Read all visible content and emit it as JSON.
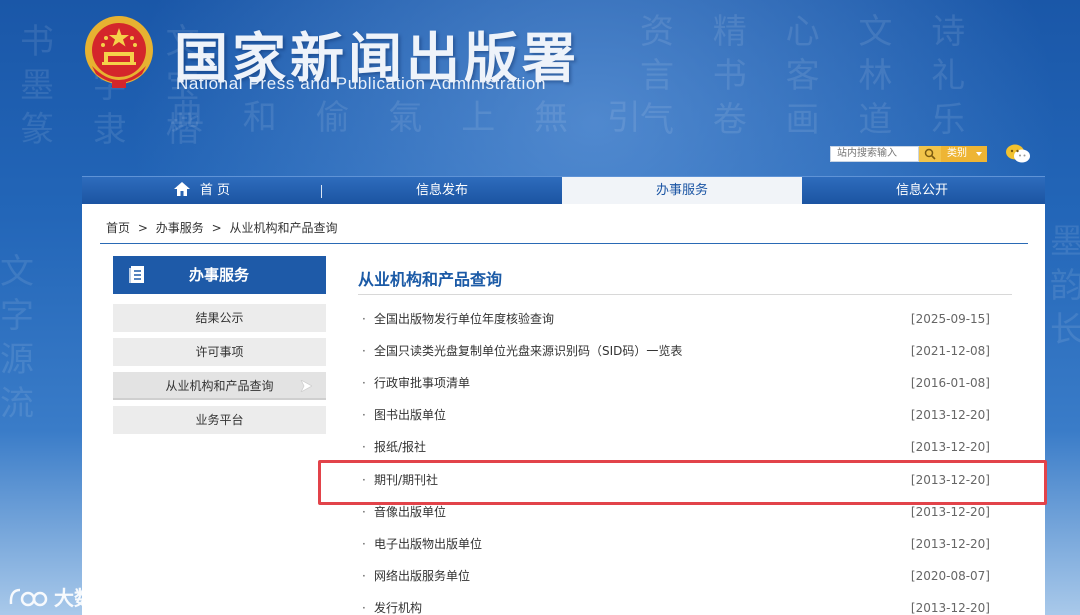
{
  "header": {
    "title_cn": "国家新闻出版署",
    "title_en": "National  Press and Publication Administration",
    "search_placeholder": "站内搜索输入",
    "category_label": "类别",
    "emblem_icon": "national-emblem-icon",
    "wechat_icon": "wechat-icon"
  },
  "nav": {
    "items": [
      {
        "label": "首 页"
      },
      {
        "label": "信息发布"
      },
      {
        "label": "办事服务"
      },
      {
        "label": "信息公开"
      }
    ],
    "active_index": 2
  },
  "breadcrumb": {
    "items": [
      "首页",
      ">",
      "办事服务",
      ">",
      "从业机构和产品查询"
    ]
  },
  "sidebar": {
    "heading": "办事服务",
    "items": [
      {
        "label": "结果公示"
      },
      {
        "label": "许可事项"
      },
      {
        "label": "从业机构和产品查询"
      },
      {
        "label": "业务平台"
      }
    ]
  },
  "main": {
    "title": "从业机构和产品查询",
    "list": [
      {
        "text": "全国出版物发行单位年度核验查询",
        "date": "[2025-09-15]"
      },
      {
        "text": "全国只读类光盘复制单位光盘来源识别码（SID码）一览表",
        "date": "[2021-12-08]"
      },
      {
        "text": "行政审批事项清单",
        "date": "[2016-01-08]"
      },
      {
        "text": "图书出版单位",
        "date": "[2013-12-20]"
      },
      {
        "text": "报纸/报社",
        "date": "[2013-12-20]"
      },
      {
        "text": "期刊/期刊社",
        "date": "[2013-12-20]"
      },
      {
        "text": "音像出版单位",
        "date": "[2013-12-20]"
      },
      {
        "text": "电子出版物出版单位",
        "date": "[2013-12-20]"
      },
      {
        "text": "网络出版服务单位",
        "date": "[2020-08-07]"
      },
      {
        "text": "发行机构",
        "date": "[2013-12-20]"
      }
    ]
  },
  "watermark": {
    "text": "大数跨境",
    "logo_text": "℡"
  },
  "colors": {
    "brand_blue": "#1e5aa8",
    "highlight_red": "#e2434a"
  }
}
